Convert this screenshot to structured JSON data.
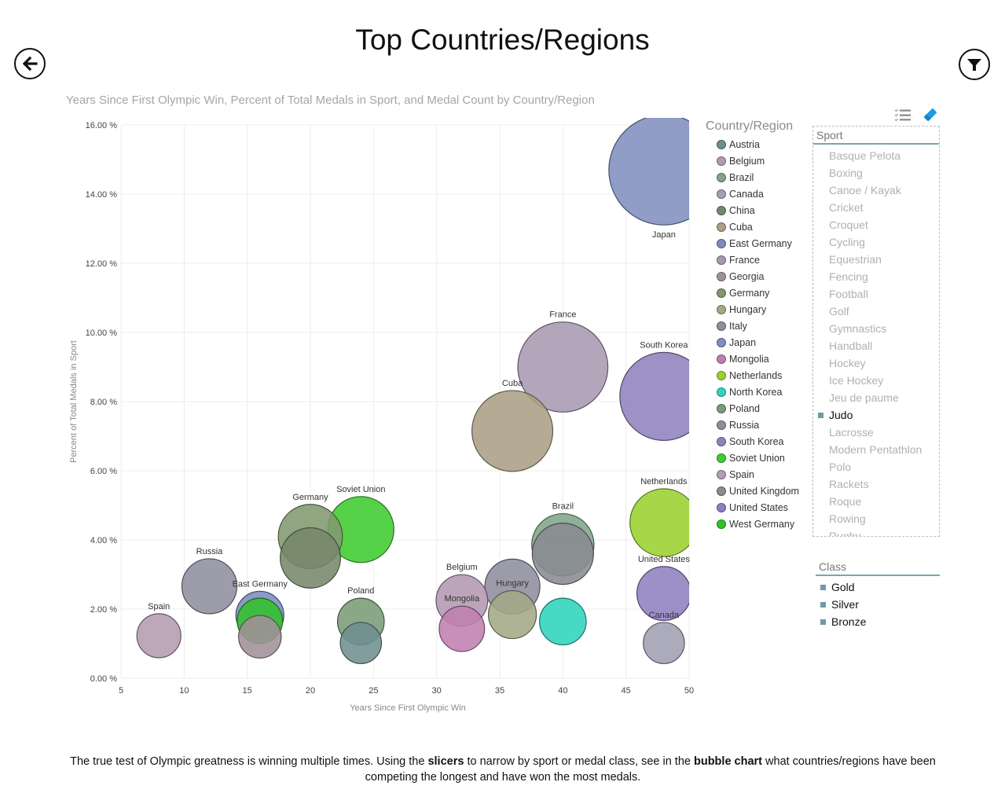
{
  "page": {
    "title": "Top Countries/Regions",
    "back_button_icon": "back-arrow-icon",
    "filter_button_icon": "filter-funnel-icon"
  },
  "chart_data": {
    "type": "scatter",
    "subtype": "bubble",
    "title": "Years Since First Olympic Win, Percent of Total Medals in Sport, and Medal Count by Country/Region",
    "xlabel": "Years Since First Olympic Win",
    "ylabel": "Percent of Total Medals in Sport",
    "size_label": "Medal Count",
    "xlim": [
      5,
      50
    ],
    "ylim": [
      0,
      16
    ],
    "x_ticks": [
      "5",
      "10",
      "15",
      "20",
      "25",
      "30",
      "35",
      "40",
      "45",
      "50"
    ],
    "y_ticks": [
      "0.00 %",
      "2.00 %",
      "4.00 %",
      "6.00 %",
      "8.00 %",
      "10.00 %",
      "12.00 %",
      "14.00 %",
      "16.00 %"
    ],
    "grid": true,
    "legend_title": "Country/Region",
    "legend_position": "right",
    "series": [
      {
        "name": "Austria",
        "color": "#6f8f8f",
        "x": 24,
        "y": 1.02,
        "size": 14,
        "label": ""
      },
      {
        "name": "Belgium",
        "color": "#b399b0",
        "x": 32,
        "y": 2.25,
        "size": 22,
        "label": "Belgium"
      },
      {
        "name": "Brazil",
        "color": "#7fa688",
        "x": 40,
        "y": 3.86,
        "size": 32,
        "label": "Brazil"
      },
      {
        "name": "Canada",
        "color": "#a09fb3",
        "x": 48,
        "y": 1.02,
        "size": 14,
        "label": "Canada"
      },
      {
        "name": "China",
        "color": "#76886a",
        "x": 20,
        "y": 3.48,
        "size": 30,
        "label": ""
      },
      {
        "name": "Cuba",
        "color": "#ab9f85",
        "x": 36,
        "y": 7.15,
        "size": 54,
        "label": "Cuba"
      },
      {
        "name": "East Germany",
        "color": "#7b8cc0",
        "x": 16,
        "y": 1.82,
        "size": 19,
        "label": "East Germany"
      },
      {
        "name": "France",
        "color": "#a898b0",
        "x": 40,
        "y": 9.0,
        "size": 67,
        "label": "France"
      },
      {
        "name": "Georgia",
        "color": "#a09198",
        "x": 16,
        "y": 1.2,
        "size": 15,
        "label": ""
      },
      {
        "name": "Germany",
        "color": "#82986f",
        "x": 20,
        "y": 4.1,
        "size": 34,
        "label": "Germany"
      },
      {
        "name": "Hungary",
        "color": "#a3a886",
        "x": 36,
        "y": 1.84,
        "size": 19,
        "label": "Hungary"
      },
      {
        "name": "Italy",
        "color": "#8e8d9e",
        "x": 36,
        "y": 2.65,
        "size": 25,
        "label": ""
      },
      {
        "name": "Japan",
        "color": "#7f8fbf",
        "x": 48,
        "y": 14.7,
        "size": 100,
        "label": "Japan"
      },
      {
        "name": "Mongolia",
        "color": "#c07fb0",
        "x": 32,
        "y": 1.43,
        "size": 17,
        "label": "Mongolia"
      },
      {
        "name": "Netherlands",
        "color": "#9bd130",
        "x": 48,
        "y": 4.5,
        "size": 38,
        "label": "Netherlands"
      },
      {
        "name": "North Korea",
        "color": "#2fd4bc",
        "x": 40,
        "y": 1.64,
        "size": 18,
        "label": ""
      },
      {
        "name": "Poland",
        "color": "#7a9b78",
        "x": 24,
        "y": 1.64,
        "size": 18,
        "label": "Poland"
      },
      {
        "name": "Russia",
        "color": "#8f8e9f",
        "x": 12,
        "y": 2.66,
        "size": 25,
        "label": "Russia"
      },
      {
        "name": "South Korea",
        "color": "#8f82bd",
        "x": 48,
        "y": 8.15,
        "size": 64,
        "label": "South Korea"
      },
      {
        "name": "Soviet Union",
        "color": "#3fcc2f",
        "x": 24,
        "y": 4.3,
        "size": 36,
        "label": "Soviet Union"
      },
      {
        "name": "Spain",
        "color": "#b49cb2",
        "x": 8,
        "y": 1.23,
        "size": 16,
        "label": "Spain"
      },
      {
        "name": "United Kingdom",
        "color": "#8a8a92",
        "x": 40,
        "y": 3.6,
        "size": 31,
        "label": ""
      },
      {
        "name": "United States",
        "color": "#907fc0",
        "x": 48,
        "y": 2.45,
        "size": 24,
        "label": "United States"
      },
      {
        "name": "West Germany",
        "color": "#33c02b",
        "x": 16,
        "y": 1.66,
        "size": 17,
        "label": ""
      }
    ]
  },
  "slicer_tools": {
    "select_icon": "multi-select-list-icon",
    "clear_icon": "eraser-clear-icon"
  },
  "sport_slicer": {
    "header": "Sport",
    "items": [
      {
        "label": "Basque Pelota",
        "selected": false
      },
      {
        "label": "Boxing",
        "selected": false
      },
      {
        "label": "Canoe / Kayak",
        "selected": false
      },
      {
        "label": "Cricket",
        "selected": false
      },
      {
        "label": "Croquet",
        "selected": false
      },
      {
        "label": "Cycling",
        "selected": false
      },
      {
        "label": "Equestrian",
        "selected": false
      },
      {
        "label": "Fencing",
        "selected": false
      },
      {
        "label": "Football",
        "selected": false
      },
      {
        "label": "Golf",
        "selected": false
      },
      {
        "label": "Gymnastics",
        "selected": false
      },
      {
        "label": "Handball",
        "selected": false
      },
      {
        "label": "Hockey",
        "selected": false
      },
      {
        "label": "Ice Hockey",
        "selected": false
      },
      {
        "label": "Jeu de paume",
        "selected": false
      },
      {
        "label": "Judo",
        "selected": true
      },
      {
        "label": "Lacrosse",
        "selected": false
      },
      {
        "label": "Modern Pentathlon",
        "selected": false
      },
      {
        "label": "Polo",
        "selected": false
      },
      {
        "label": "Rackets",
        "selected": false
      },
      {
        "label": "Roque",
        "selected": false
      },
      {
        "label": "Rowing",
        "selected": false
      },
      {
        "label": "Rugby",
        "selected": false
      }
    ]
  },
  "class_slicer": {
    "header": "Class",
    "items": [
      {
        "label": "Gold"
      },
      {
        "label": "Silver"
      },
      {
        "label": "Bronze"
      }
    ]
  },
  "footer": {
    "part1": "The true test of Olympic greatness is winning multiple times. Using the ",
    "bold1": "slicers",
    "part2": " to narrow by sport or medal class, see in the ",
    "bold2": "bubble chart",
    "part3": " what countries/regions have been competing the longest and have won the most medals."
  }
}
